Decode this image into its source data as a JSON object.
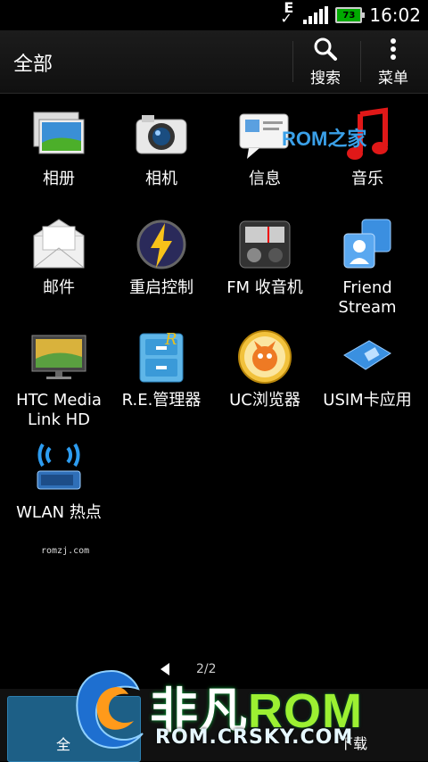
{
  "status": {
    "battery_level": "73",
    "time": "16:02",
    "network_letter": "E"
  },
  "actionbar": {
    "title": "全部",
    "search_label": "搜索",
    "menu_label": "菜单"
  },
  "apps": [
    {
      "label": "相册",
      "icon": "gallery-icon"
    },
    {
      "label": "相机",
      "icon": "camera-icon"
    },
    {
      "label": "信息",
      "icon": "messages-icon"
    },
    {
      "label": "音乐",
      "icon": "music-icon"
    },
    {
      "label": "邮件",
      "icon": "mail-icon"
    },
    {
      "label": "重启控制",
      "icon": "reboot-control-icon"
    },
    {
      "label": "FM 收音机",
      "icon": "fm-radio-icon"
    },
    {
      "label": "Friend\nStream",
      "icon": "friend-stream-icon"
    },
    {
      "label": "HTC Media\nLink HD",
      "icon": "media-link-icon"
    },
    {
      "label": "R.E.管理器",
      "icon": "file-manager-icon"
    },
    {
      "label": "UC浏览器",
      "icon": "uc-browser-icon"
    },
    {
      "label": "USIM卡应用",
      "icon": "usim-icon"
    },
    {
      "label": "WLAN 热点",
      "icon": "wlan-hotspot-icon"
    }
  ],
  "watermarks": {
    "rom_home": "ROM之家",
    "domain": "romzj.com"
  },
  "pager": {
    "text": "2/2"
  },
  "bottombar": {
    "all_label": "全",
    "download_label": "下载"
  },
  "logo": {
    "brand": "非凡",
    "rom": "ROM",
    "url": "ROM.CRSKY.COM"
  }
}
